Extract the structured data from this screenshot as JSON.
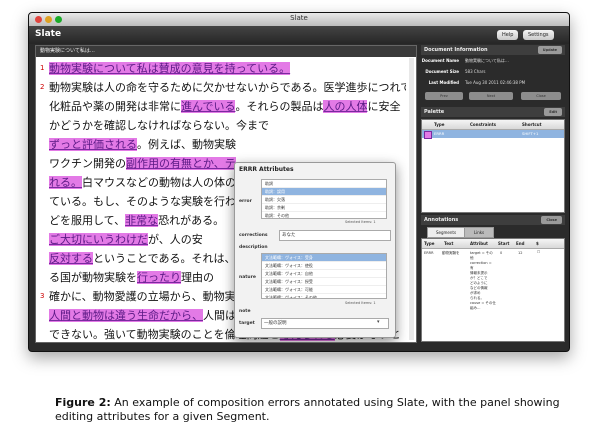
{
  "window": {
    "title": "Slate",
    "brand": "Slate",
    "buttons": [
      "Help",
      "Settings"
    ]
  },
  "document": {
    "tab_label": "動物実験について私は…",
    "lines": [
      [
        {
          "t": "動物実験について私は賛成の意見を持っている。",
          "s": "seg"
        }
      ],
      [
        {
          "t": "動物実験は人の命を守るために欠かせないからである。医学進歩につれて、",
          "s": ""
        }
      ],
      [
        {
          "t": "化粧品や薬の開発は非常に",
          "s": ""
        },
        {
          "t": "進んでいる",
          "s": "seg"
        },
        {
          "t": "。それらの製品は",
          "s": ""
        },
        {
          "t": "人の人体",
          "s": "seg"
        },
        {
          "t": "に安全",
          "s": ""
        }
      ],
      [
        {
          "t": "かどうかを確認しなければならない。",
          "s": ""
        },
        {
          "t": "",
          "s": ""
        },
        {
          "t": "今まで",
          "s": ""
        }
      ],
      [
        {
          "t": "ずっと評価される",
          "s": "seg"
        },
        {
          "t": "。例えば、動物実験",
          "s": ""
        }
      ],
      [
        {
          "t": "ワクチン開発の",
          "s": ""
        },
        {
          "t": "副作用の有無とか、テ",
          "s": "seg"
        }
      ],
      [
        {
          "t": "れる。",
          "s": "seg"
        },
        {
          "t": "白マウスなどの動物は人の体の",
          "s": ""
        }
      ],
      [
        {
          "t": "ている。もし、そのような実験を行わ",
          "s": ""
        }
      ],
      [
        {
          "t": "どを服用して、",
          "s": ""
        },
        {
          "t": "非常な",
          "s": "seg"
        },
        {
          "t": "恐れがある。",
          "s": ""
        }
      ],
      [
        {
          "t": "ご大切にいうわけだ",
          "s": "seg"
        },
        {
          "t": "が、人の安",
          "s": ""
        }
      ],
      [
        {
          "t": "反対する",
          "s": "seg"
        },
        {
          "t": "ということである。それは、",
          "s": ""
        }
      ],
      [
        {
          "t": "る国が動物実験を",
          "s": ""
        },
        {
          "t": "行ったり",
          "s": "seg"
        },
        {
          "t": "理由の",
          "s": ""
        }
      ],
      [
        {
          "t": "確かに、動物愛護の立場から、動物実",
          "s": ""
        }
      ],
      [
        {
          "t": "人間と動物は違う生命だから、",
          "s": "seg"
        },
        {
          "t": "人間は",
          "s": ""
        }
      ],
      [
        {
          "t": "できない。強いて動物実験のことを倫理問題と",
          "s": ""
        },
        {
          "t": "考えられる",
          "s": "seg"
        },
        {
          "t": "必要がないと",
          "s": ""
        }
      ],
      [
        {
          "t": "動物愛護を考え",
          "s": "seg"
        },
        {
          "t": "。しかも、動物実験を行う時、よく注意して、なるべく痛",
          "s": ""
        }
      ]
    ],
    "line_numbers": [
      "1",
      "2",
      "",
      "",
      "",
      "",
      "",
      "",
      "",
      "",
      "",
      "",
      "3",
      "",
      "",
      ""
    ]
  },
  "modal": {
    "title": "ERRR Attributes",
    "label_1": "error",
    "list_1": [
      "助詞",
      "助詞：誤用",
      "助詞：欠落",
      "助詞：余剰",
      "助詞：その他"
    ],
    "list_1_selected": 1,
    "selected_1": "Selected Items: 1",
    "corrections_label": "corrections",
    "corrections_value": "あなた",
    "description_label": "description",
    "label_2": "nature",
    "list_2": [
      "文法範疇：ヴォイス：受身",
      "文法範疇：ヴォイス：使役",
      "文法範疇：ヴォイス：自他",
      "文法範疇：ヴォイス：授受",
      "文法範疇：ヴォイス：可能",
      "文法範疇：ヴォイス：その他"
    ],
    "list_2_selected": 0,
    "selected_2": "Selected Items: 1",
    "note_label": "note",
    "target_label": "target",
    "target_value": "一般の説明"
  },
  "doc_info": {
    "header": "Document Information",
    "button": "Update",
    "rows": [
      {
        "k": "Document Name",
        "v": "動物実験について私は…"
      },
      {
        "k": "Document Size",
        "v": "583 Chars"
      },
      {
        "k": "Last Modified",
        "v": "Tue Aug 30 2011 02:46:38 PM"
      }
    ],
    "actions": [
      "Prev",
      "Next",
      "Close"
    ]
  },
  "palette": {
    "header": "Palette",
    "button": "Edit",
    "columns": [
      "Type",
      "Constraints",
      "Shortcut"
    ],
    "rows": [
      {
        "type": "ERRR",
        "constraints": "",
        "shortcut": "SHIFT+1"
      }
    ]
  },
  "annotations": {
    "header": "Annotations",
    "button": "Close",
    "tabs": [
      "Segments",
      "Links"
    ],
    "columns": [
      "Type",
      "Text",
      "Attribut",
      "Start",
      "End",
      "$"
    ],
    "row": {
      "type": "ERRR",
      "text": "動物実験を",
      "attr": [
        "target = その他",
        "correction = 有",
        "情報未提示",
        "か？どこで",
        "どのように",
        "などの情報",
        "が求め",
        "られる。",
        "cause = その仕",
        "組み…"
      ],
      "start": "0",
      "end": "12",
      "flag": "☐"
    }
  },
  "caption": {
    "label": "Figure 2:",
    "text": "An example of composition errors annotated using Slate, with the panel showing editing attributes for a given Segment."
  },
  "colors": {
    "segment": "#e37ae6",
    "selection": "#8fb4e0",
    "chrome": "#2b2b2b"
  }
}
